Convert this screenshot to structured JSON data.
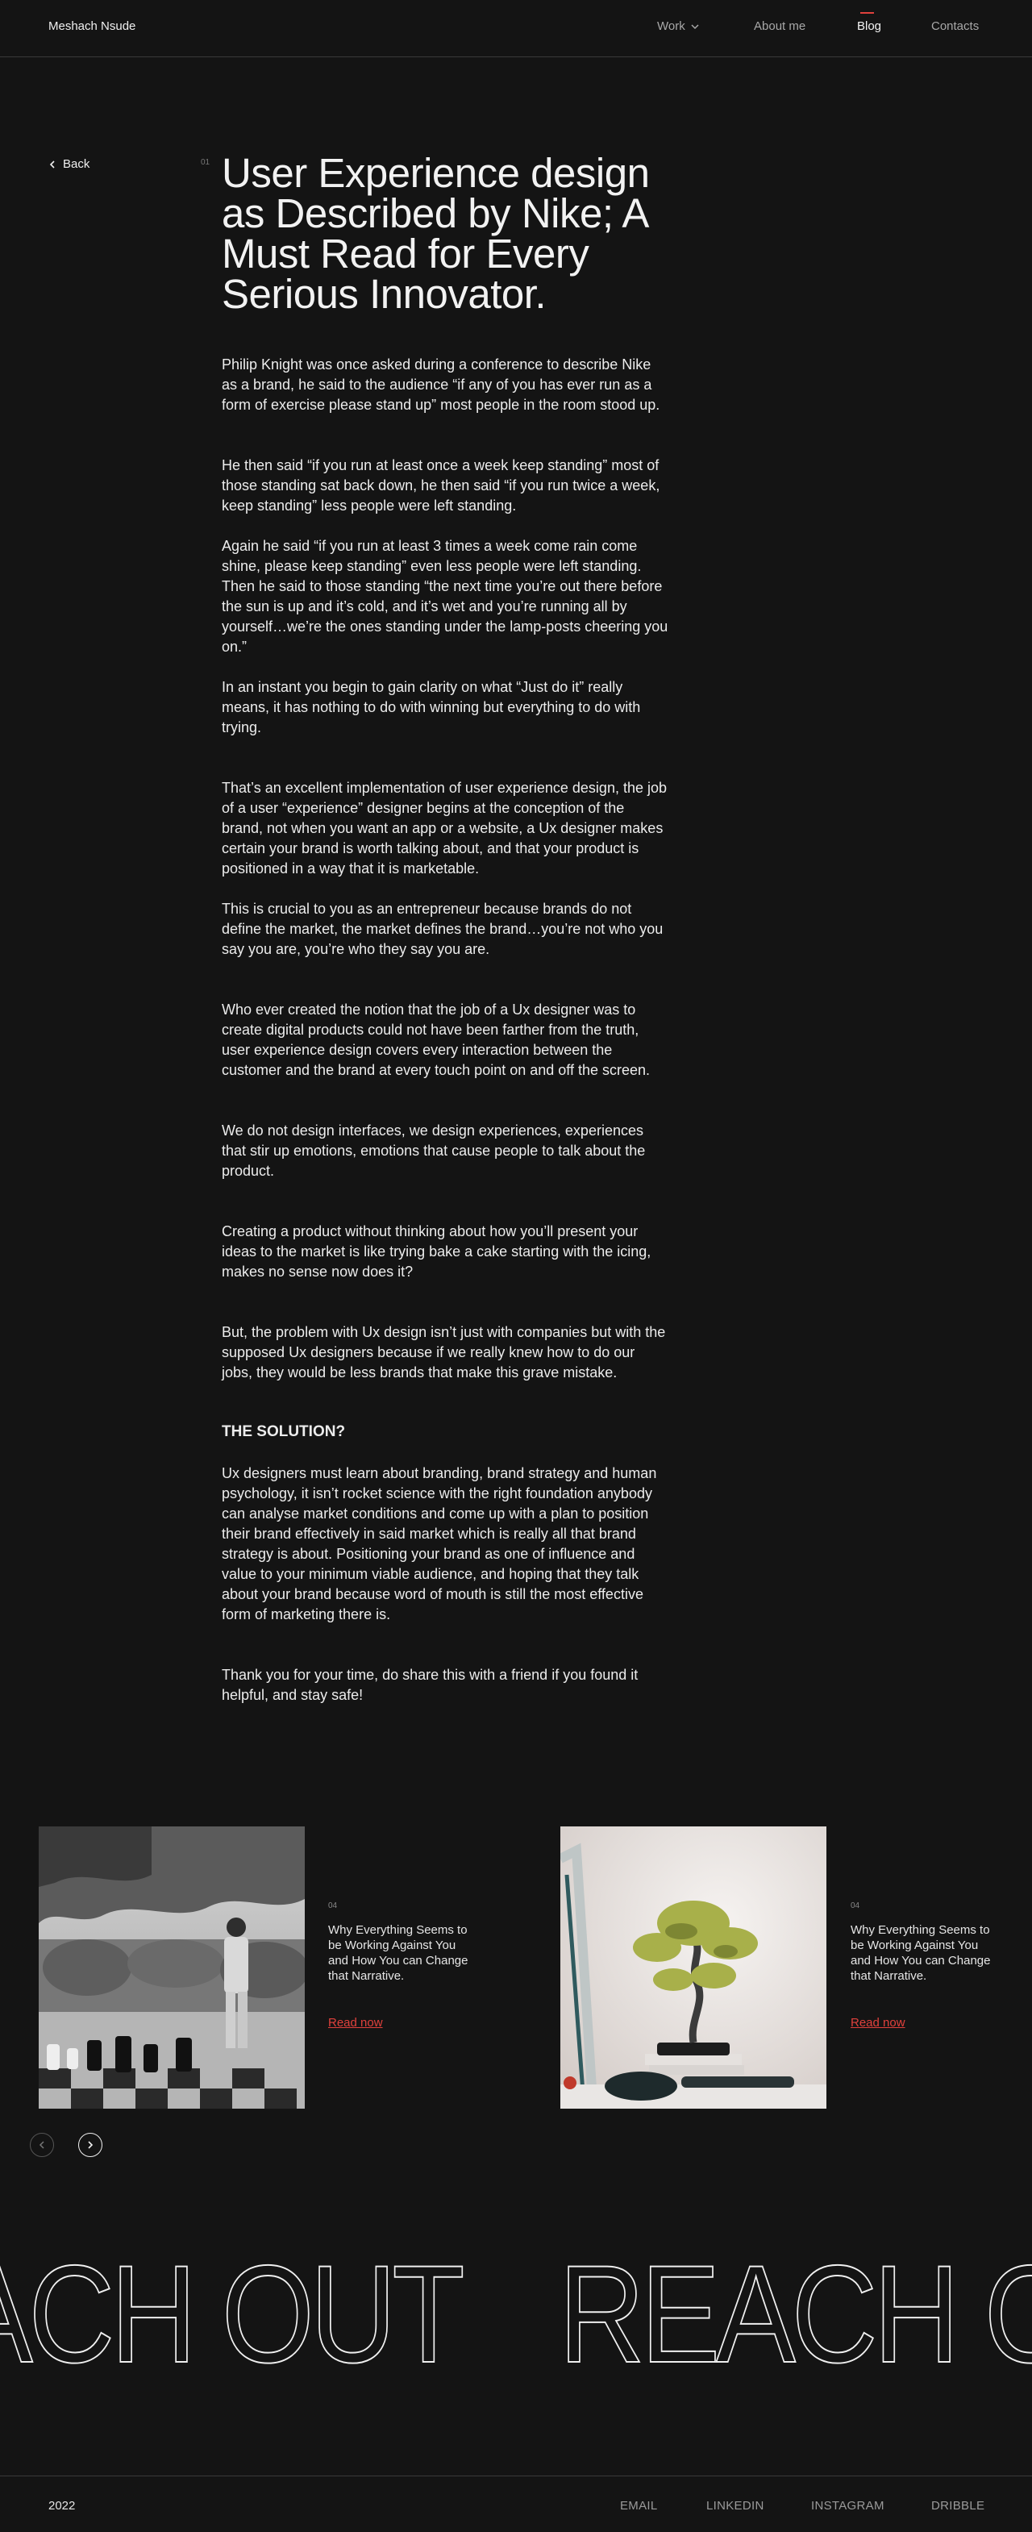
{
  "header": {
    "brand": "Meshach Nsude",
    "nav": {
      "work": "Work",
      "about": "About me",
      "blog": "Blog",
      "contacts": "Contacts"
    },
    "active_item": "Blog",
    "accent": "#e0413c"
  },
  "article": {
    "back_label": "Back",
    "number": "01",
    "title": "User Experience design as Described by Nike; A Must Read for Every Serious Innovator.",
    "paragraphs": [
      "Philip Knight was once asked during a conference to describe Nike as a brand, he said to the audience “if any of you has ever run as a form of exercise please stand up” most people in the room stood up.",
      "He then said “if you run at least once a week keep standing” most of those standing sat back down, he then said “if you run twice a week, keep standing” less people were left standing.",
      "Again he said “if you run at least 3 times a week come rain come shine, please keep standing” even less people were left standing. Then he said to those standing “the next time you’re out there before the sun is up and it’s cold, and it’s wet and you’re running all by yourself…we’re the ones standing under the lamp-posts cheering you on.”",
      "In an instant you begin to gain clarity on what “Just do it” really means, it has nothing to do with winning but everything to do with trying.",
      "That’s an excellent implementation of user experience design, the job of a user “experience” designer begins at the conception of the brand, not when you want an app or a website, a Ux designer makes certain your brand is worth talking about, and that your product is positioned in a way that it is marketable.",
      "This is crucial to you as an entrepreneur because brands do not define the market, the market defines the brand…you’re not who you say you are, you’re who they say you are.",
      "Who ever created the notion that the job of a Ux designer was to create digital products could not have been farther from the truth, user experience design covers every interaction between the customer and the brand at every touch point on and off the screen.",
      "We do not design interfaces, we design experiences, experiences that stir up emotions, emotions that cause people to talk about the product.",
      "Creating a product without thinking about how you’ll present your ideas to the market is like trying bake a cake starting with the icing, makes no sense now does it?",
      "But, the problem with Ux design isn’t just with companies but with the supposed Ux designers because if we really knew how to do our jobs, they would be less brands that make this grave mistake.",
      "Ux designers must learn about branding, brand strategy and human psychology, it isn’t rocket science with the right foundation anybody can analyse market conditions and come up with a plan to position their brand effectively in said market which is really all that brand strategy is about. Positioning your brand as one of influence and value to your minimum viable audience, and hoping that they talk about your brand because word of mouth is still the most effective form of marketing there is.",
      "Thank you for your time, do share this with a friend if you found it helpful, and stay safe!"
    ],
    "solution_heading": "THE SOLUTION?"
  },
  "related": {
    "cards": [
      {
        "number": "04",
        "title": "Why Everything Seems to be Working Against You and How You can Change that Narrative.",
        "link": "Read now",
        "image": "chess-player-photo"
      },
      {
        "number": "04",
        "title": "Why Everything Seems to be Working Against You and How You can Change that Narrative.",
        "link": "Read now",
        "image": "bonsai-tree-photo"
      }
    ],
    "prev_icon": "chevron-left-icon",
    "next_icon": "chevron-right-icon"
  },
  "reach_out": {
    "text_one": "ACH OUT",
    "text_two": "REACH O"
  },
  "footer": {
    "year": "2022",
    "links": {
      "email": "EMAIL",
      "linkedin": "LINKEDIN",
      "instagram": "INSTAGRAM",
      "dribble": "DRIBBLE"
    }
  }
}
